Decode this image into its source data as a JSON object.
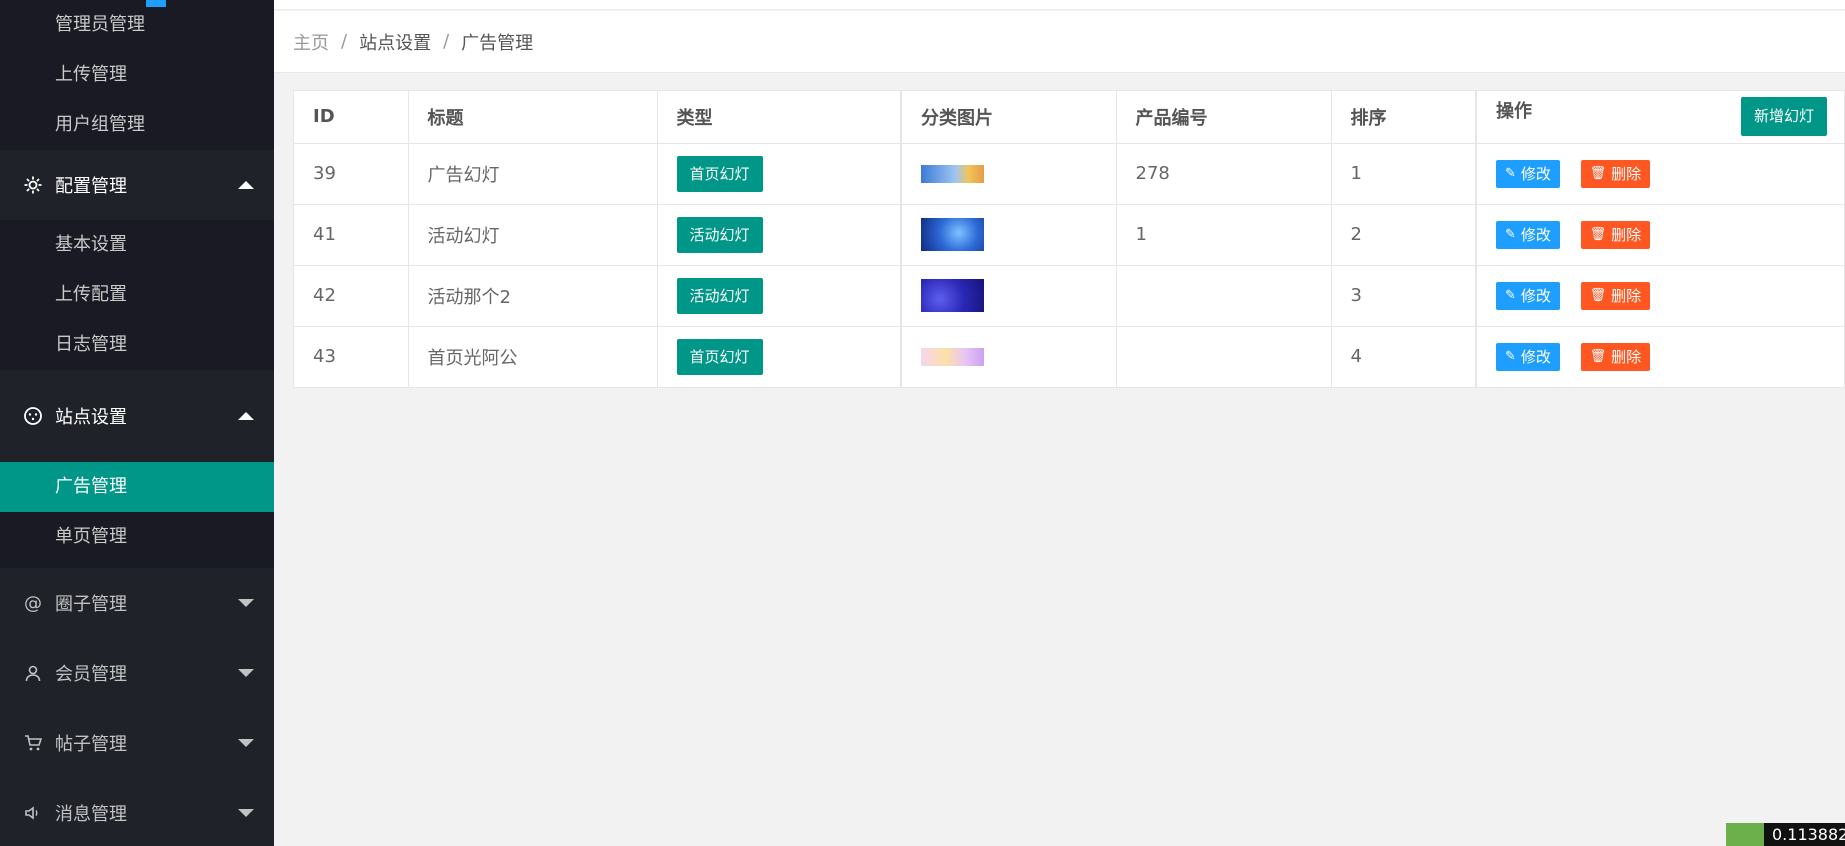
{
  "sidebar": {
    "sub_top": [
      "管理员管理",
      "上传管理",
      "用户组管理"
    ],
    "config_group": "配置管理",
    "config_items": [
      "基本设置",
      "上传配置",
      "日志管理"
    ],
    "site_group": "站点设置",
    "site_items": [
      "广告管理",
      "单页管理"
    ],
    "groups_collapsed": [
      {
        "label": "圈子管理",
        "icon": "at-icon"
      },
      {
        "label": "会员管理",
        "icon": "user-icon"
      },
      {
        "label": "帖子管理",
        "icon": "cart-icon"
      },
      {
        "label": "消息管理",
        "icon": "speaker-icon"
      }
    ]
  },
  "breadcrumb": {
    "home": "主页",
    "sep": "/",
    "section": "站点设置",
    "page": "广告管理"
  },
  "table": {
    "headers": [
      "ID",
      "标题",
      "类型",
      "分类图片",
      "产品编号",
      "排序",
      "操作"
    ],
    "add_button": "新增幻灯",
    "edit_label": "修改",
    "delete_label": "删除",
    "rows": [
      {
        "id": "39",
        "title": "广告幻灯",
        "type": "首页幻灯",
        "product": "278",
        "sort": "1"
      },
      {
        "id": "41",
        "title": "活动幻灯",
        "type": "活动幻灯",
        "product": "1",
        "sort": "2"
      },
      {
        "id": "42",
        "title": "活动那个2",
        "type": "活动幻灯",
        "product": "",
        "sort": "3"
      },
      {
        "id": "43",
        "title": "首页光阿公",
        "type": "首页幻灯",
        "product": "",
        "sort": "4"
      }
    ]
  },
  "corner_value": "0.113882",
  "colors": {
    "accent": "#009688",
    "edit": "#1e9fff",
    "delete": "#ff5722",
    "sidebar": "#20222a"
  }
}
